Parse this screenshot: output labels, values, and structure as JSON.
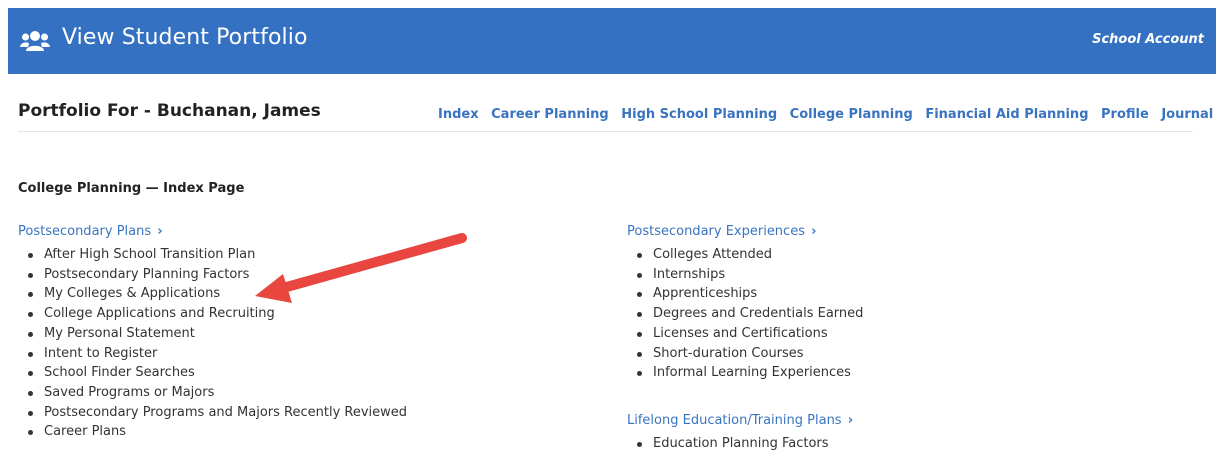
{
  "header": {
    "title": "View Student Portfolio",
    "account_label": "School Account",
    "icon": "users-icon",
    "color": "#3471c2"
  },
  "portfolio": {
    "title": "Portfolio For - Buchanan, James"
  },
  "nav": [
    "Index",
    "Career Planning",
    "High School Planning",
    "College Planning",
    "Financial Aid Planning",
    "Profile",
    "Journal"
  ],
  "section_title": "College Planning — Index Page",
  "columns": {
    "postsecondary_plans": {
      "heading": "Postsecondary Plans",
      "items": [
        "After High School Transition Plan",
        "Postsecondary Planning Factors",
        "My Colleges & Applications",
        "College Applications and Recruiting",
        "My Personal Statement",
        "Intent to Register",
        "School Finder Searches",
        "Saved Programs or Majors",
        "Postsecondary Programs and Majors Recently Reviewed",
        "Career Plans"
      ]
    },
    "postsecondary_experiences": {
      "heading": "Postsecondary Experiences",
      "items": [
        "Colleges Attended",
        "Internships",
        "Apprenticeships",
        "Degrees and Credentials Earned",
        "Licenses and Certifications",
        "Short-duration Courses",
        "Informal Learning Experiences"
      ]
    },
    "lifelong_education": {
      "heading": "Lifelong Education/Training Plans",
      "items": [
        "Education Planning Factors"
      ]
    }
  },
  "chevron": "›",
  "annotation": {
    "color": "#e8463f"
  }
}
